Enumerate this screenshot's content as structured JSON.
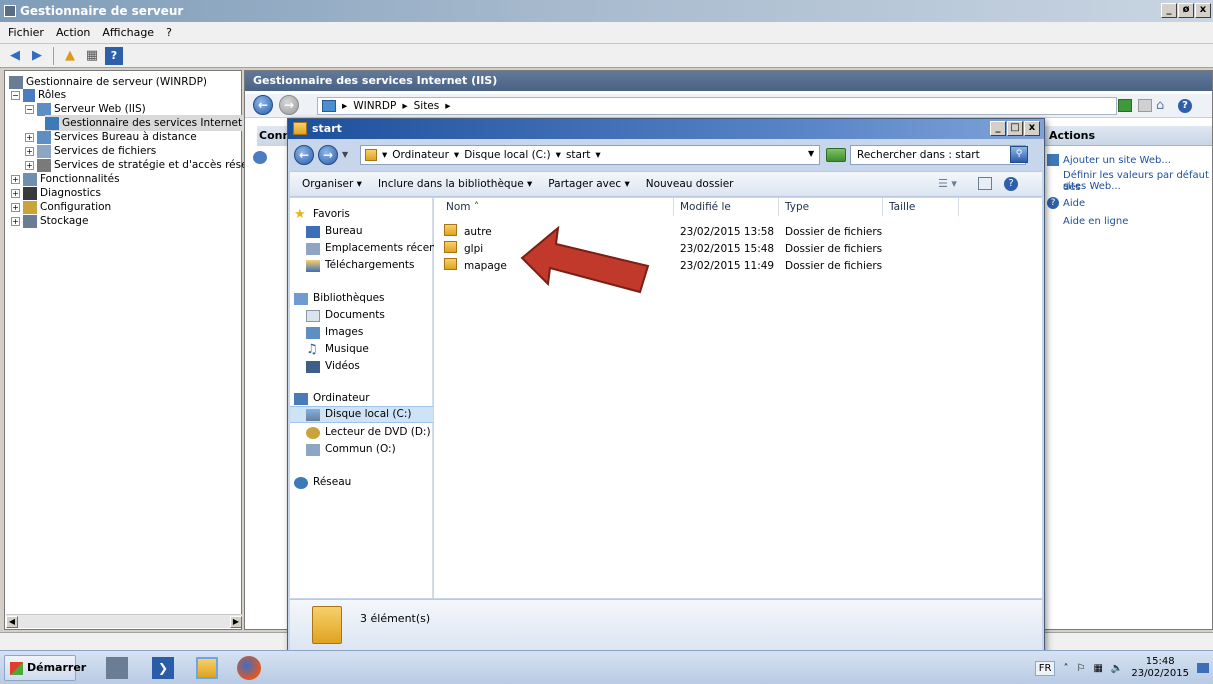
{
  "window": {
    "title": "Gestionnaire de serveur",
    "controls": [
      "_",
      "ø",
      "x"
    ]
  },
  "menu": [
    "Fichier",
    "Action",
    "Affichage",
    "?"
  ],
  "tree": {
    "root": "Gestionnaire de serveur (WINRDP)",
    "roles": "Rôles",
    "web_server": "Serveur Web (IIS)",
    "iis_manager": "Gestionnaire des services Internet (IIS",
    "rds": "Services Bureau à distance",
    "file_services": "Services de fichiers",
    "npas": "Services de stratégie et d'accès réseau",
    "features": "Fonctionnalités",
    "diagnostics": "Diagnostics",
    "configuration": "Configuration",
    "storage": "Stockage"
  },
  "iis": {
    "header": "Gestionnaire des services Internet (IIS)",
    "crumbs": [
      "WINRDP",
      "Sites"
    ],
    "connections_stub": "Conne:",
    "actions_title": "Actions",
    "actions": [
      "Ajouter un site Web...",
      "Définir les valeurs par défaut des",
      "sites Web...",
      "Aide",
      "Aide en ligne"
    ]
  },
  "explorer": {
    "title": "start",
    "path": [
      "Ordinateur",
      "Disque local (C:)",
      "start"
    ],
    "search_placeholder": "Rechercher dans : start",
    "commands": [
      "Organiser",
      "Inclure dans la bibliothèque",
      "Partager avec",
      "Nouveau dossier"
    ],
    "nav": {
      "favorites": "Favoris",
      "desktop": "Bureau",
      "recent": "Emplacements récents",
      "downloads": "Téléchargements",
      "libraries": "Bibliothèques",
      "documents": "Documents",
      "images": "Images",
      "music": "Musique",
      "videos": "Vidéos",
      "computer": "Ordinateur",
      "local_disk": "Disque local (C:)",
      "dvd": "Lecteur de DVD (D:) FI",
      "common": "Commun (O:)",
      "network": "Réseau"
    },
    "columns": [
      "Nom",
      "Modifié le",
      "Type",
      "Taille"
    ],
    "files": [
      {
        "name": "autre",
        "modified": "23/02/2015 13:58",
        "type": "Dossier de fichiers"
      },
      {
        "name": "glpi",
        "modified": "23/02/2015 15:48",
        "type": "Dossier de fichiers"
      },
      {
        "name": "mapage",
        "modified": "23/02/2015 11:49",
        "type": "Dossier de fichiers"
      }
    ],
    "item_count": "3 élément(s)"
  },
  "taskbar": {
    "start": "Démarrer",
    "lang": "FR",
    "time": "15:48",
    "date": "23/02/2015"
  },
  "colors": {
    "arrow": "#c0392b",
    "titlebar": "#7f9db9",
    "explorer_title": "#1c4f9c"
  }
}
